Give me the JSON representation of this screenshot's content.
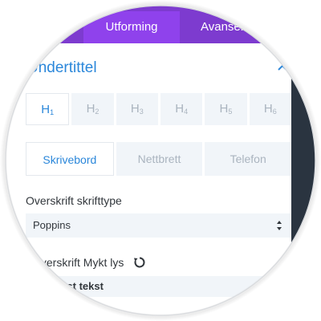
{
  "tabs": {
    "active_label": "Utforming",
    "other_label": "Avansert"
  },
  "section": {
    "title": "Undertittel"
  },
  "heading_levels": [
    {
      "main": "H",
      "sub": "1"
    },
    {
      "main": "H",
      "sub": "2"
    },
    {
      "main": "H",
      "sub": "3"
    },
    {
      "main": "H",
      "sub": "4"
    },
    {
      "main": "H",
      "sub": "5"
    },
    {
      "main": "H",
      "sub": "6"
    }
  ],
  "devices": {
    "desktop": "Skrivebord",
    "tablet": "Nettbrett",
    "phone": "Telefon"
  },
  "font_field": {
    "label": "Overskrift skrifttype",
    "value": "Poppins"
  },
  "weight_field": {
    "label": "Overskrift Mykt lys",
    "value": "Tekst tekst"
  },
  "colors": {
    "accent": "#2b87da",
    "tabbar": "#7d3bcf",
    "tab_active": "#8f42ec"
  }
}
